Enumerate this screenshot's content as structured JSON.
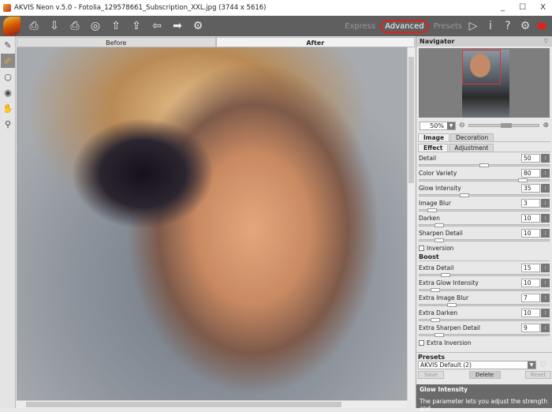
{
  "window": {
    "title": "AKVIS Neon v.5.0 - Fotolia_129578661_Subscription_XXL.jpg (3744 x 5616)",
    "min": "_",
    "max": "☐",
    "close": "X"
  },
  "toolbar": {
    "icons": [
      "open-icon",
      "save-icon",
      "print-icon",
      "share-icon",
      "import-icon",
      "export-icon",
      "back-icon",
      "forward-icon",
      "batch-gear-icon"
    ],
    "modes": {
      "express": "Express",
      "advanced": "Advanced",
      "presets": "Presets"
    },
    "active_mode": "Advanced",
    "accent": "#e0201b"
  },
  "view_tabs": {
    "before": "Before",
    "after": "After"
  },
  "navigator": {
    "title": "Navigator",
    "zoom": "50%",
    "zoom_slider": 0.5
  },
  "tabs": {
    "image": "Image",
    "decoration": "Decoration",
    "effect": "Effect",
    "adjustment": "Adjustment"
  },
  "params": [
    {
      "label": "Detail",
      "value": "50",
      "frac": 0.5
    },
    {
      "label": "Color Variety",
      "value": "80",
      "frac": 0.8
    },
    {
      "label": "Glow Intensity",
      "value": "35",
      "frac": 0.35
    },
    {
      "label": "Image Blur",
      "value": "3",
      "frac": 0.1
    },
    {
      "label": "Darken",
      "value": "10",
      "frac": 0.15
    },
    {
      "label": "Sharpen Detail",
      "value": "10",
      "frac": 0.15
    }
  ],
  "inversion": "Inversion",
  "boost_title": "Boost",
  "boost": [
    {
      "label": "Extra Detail",
      "value": "15",
      "frac": 0.2
    },
    {
      "label": "Extra Glow Intensity",
      "value": "10",
      "frac": 0.12
    },
    {
      "label": "Extra Image Blur",
      "value": "7",
      "frac": 0.25
    },
    {
      "label": "Extra Darken",
      "value": "10",
      "frac": 0.12
    },
    {
      "label": "Extra Sharpen Detail",
      "value": "9",
      "frac": 0.15
    }
  ],
  "extra_inversion": "Extra Inversion",
  "presets": {
    "title": "Presets",
    "selected": "AKVIS Default (2)",
    "save": "Save",
    "delete": "Delete",
    "reset": "Reset"
  },
  "help": {
    "title": "Glow Intensity",
    "text": "The parameter lets you adjust the strength and"
  }
}
